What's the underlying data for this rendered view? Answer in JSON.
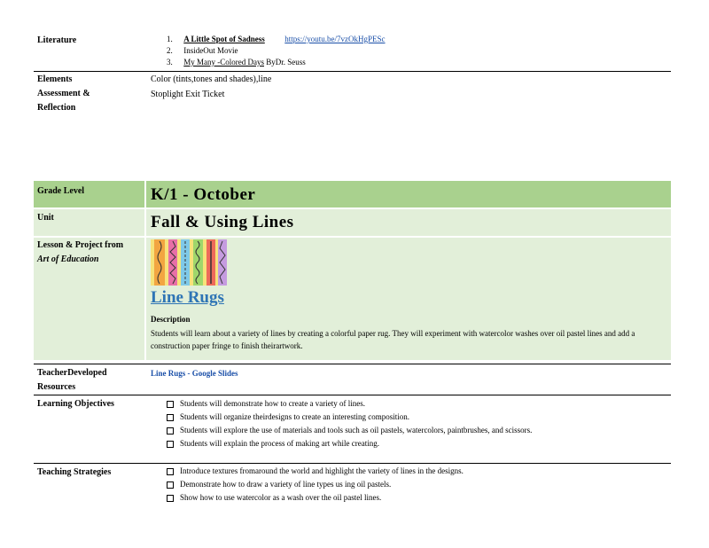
{
  "literature": {
    "label": "Literature",
    "items": [
      {
        "num": "1.",
        "title": "A Little Spot of Sadness",
        "link": "https://youtu.be/7vzOkHgPESc"
      },
      {
        "num": "2.",
        "title": "InsideOut Movie"
      },
      {
        "num": "3.",
        "title": "My Many -Colored Days",
        "by": "ByDr. Seuss"
      }
    ]
  },
  "elements": {
    "label": "Elements",
    "value": "Color (tints,tones and shades),line"
  },
  "assessment": {
    "label": "Assessment & Reflection",
    "value": "Stoplight Exit Ticket"
  },
  "grade": {
    "label": "Grade Level",
    "value": "K/1 - October"
  },
  "unit": {
    "label": "Unit",
    "value": "Fall & Using Lines"
  },
  "lesson": {
    "label_prefix": "Lesson & Project from",
    "label_italic": "Art of Education",
    "title": "Line Rugs",
    "description_label": "Description",
    "description_text": "Students will learn about a variety of lines by creating a colorful paper rug. They will experiment with watercolor washes over oil pastel lines and add a construction paper fringe to finish theirartwork."
  },
  "teacher_resources": {
    "label": "TeacherDeveloped Resources",
    "link": "Line Rugs - Google Slides"
  },
  "objectives": {
    "label": "Learning Objectives",
    "items": [
      "Students will demonstrate how to create a variety of lines.",
      "Students will organize theirdesigns to create an interesting composition.",
      "Students will explore the use of materials and tools such as oil pastels, watercolors, paintbrushes, and scissors.",
      "Students will explain the process of making art while creating."
    ]
  },
  "strategies": {
    "label": "Teaching Strategies",
    "items": [
      "Introduce textures fromaround the world and highlight the variety of lines in the designs.",
      "Demonstrate how to draw a variety of line types us ing oil pastels.",
      "Show how to use watercolor as a wash over the oil pastel lines."
    ]
  }
}
